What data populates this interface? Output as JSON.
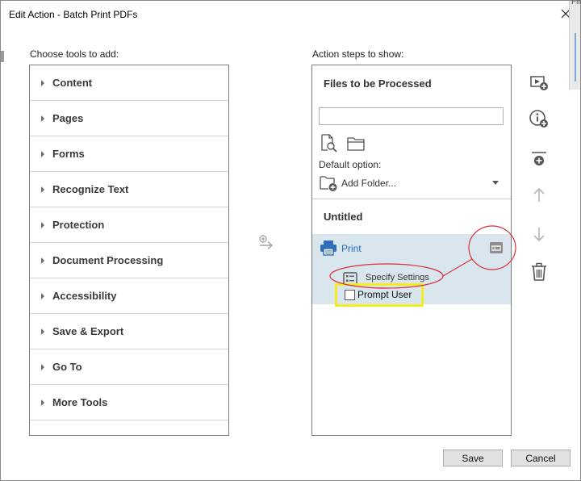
{
  "window": {
    "title": "Edit Action - Batch Print PDFs",
    "background_hint": "Files"
  },
  "left_panel": {
    "label": "Choose tools to add:",
    "tools": [
      {
        "label": "Content"
      },
      {
        "label": "Pages"
      },
      {
        "label": "Forms"
      },
      {
        "label": "Recognize Text"
      },
      {
        "label": "Protection"
      },
      {
        "label": "Document Processing"
      },
      {
        "label": "Accessibility"
      },
      {
        "label": "Save & Export"
      },
      {
        "label": "Go To"
      },
      {
        "label": "More Tools"
      }
    ]
  },
  "right_panel": {
    "label": "Action steps to show:",
    "files_header": "Files to be Processed",
    "files_input_value": "",
    "default_option_label": "Default option:",
    "add_folder_label": "Add Folder...",
    "group_title": "Untitled",
    "step": {
      "label": "Print",
      "specify_settings_label": "Specify Settings",
      "prompt_user_label": "Prompt User",
      "prompt_user_checked": false
    }
  },
  "side_tools": [
    {
      "icon": "add-step-icon"
    },
    {
      "icon": "add-instruction-icon"
    },
    {
      "icon": "add-separator-icon"
    },
    {
      "icon": "move-up-icon"
    },
    {
      "icon": "move-down-icon"
    },
    {
      "icon": "delete-icon"
    }
  ],
  "buttons": {
    "save_label": "Save",
    "cancel_label": "Cancel"
  },
  "colors": {
    "selected_step_bg": "#d9e6ee",
    "link_blue": "#2a6ebb",
    "annotation_red": "#d8303a",
    "annotation_yellow": "#f3ec21"
  }
}
